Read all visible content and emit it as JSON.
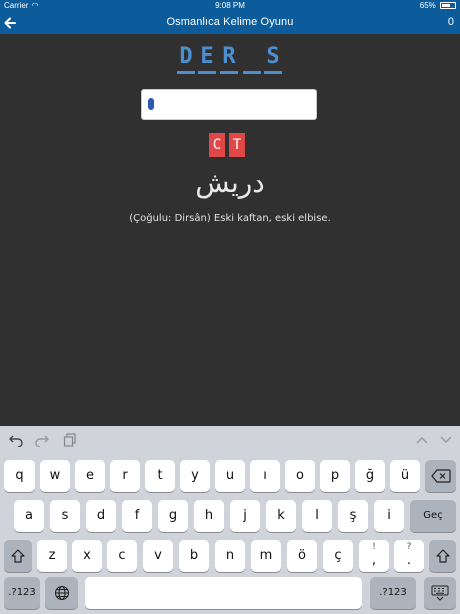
{
  "status_bar": {
    "carrier": "Carrier",
    "time": "9:08 PM",
    "battery": "65%",
    "battery_level": 0.65
  },
  "nav": {
    "title": "Osmanlıca Kelime Oyunu",
    "score": "0",
    "back_icon": "arrow-left-icon"
  },
  "word": {
    "letters": [
      "D",
      "E",
      "R",
      "",
      "S"
    ]
  },
  "answer_input": {
    "value": "",
    "placeholder": ""
  },
  "hints": [
    "C",
    "T"
  ],
  "arabic_word": "دریش",
  "meaning": "(Çoğulu: Dirsân) Eski kaftan, eski elbise.",
  "keyboard": {
    "toolbar": {
      "undo_icon": "undo-icon",
      "redo_icon": "redo-icon",
      "paste_icon": "paste-icon",
      "up_icon": "chevron-up-icon",
      "down_icon": "chevron-down-icon"
    },
    "row1": [
      "q",
      "w",
      "e",
      "r",
      "t",
      "y",
      "u",
      "ı",
      "o",
      "p",
      "ğ",
      "ü"
    ],
    "row2": [
      "a",
      "s",
      "d",
      "f",
      "g",
      "h",
      "j",
      "k",
      "l",
      "ş",
      "i"
    ],
    "row3": [
      "z",
      "x",
      "c",
      "v",
      "b",
      "n",
      "m",
      "ö",
      "ç"
    ],
    "row3_punct": [
      {
        "top": "!",
        "main": ","
      },
      {
        "top": "?",
        "main": "."
      }
    ],
    "return_label": "Geç",
    "numbers_label": ".?123",
    "globe_icon": "globe-icon",
    "delete_icon": "delete-icon",
    "shift_icon": "shift-icon",
    "hide_keyboard_icon": "keyboard-hide-icon"
  }
}
